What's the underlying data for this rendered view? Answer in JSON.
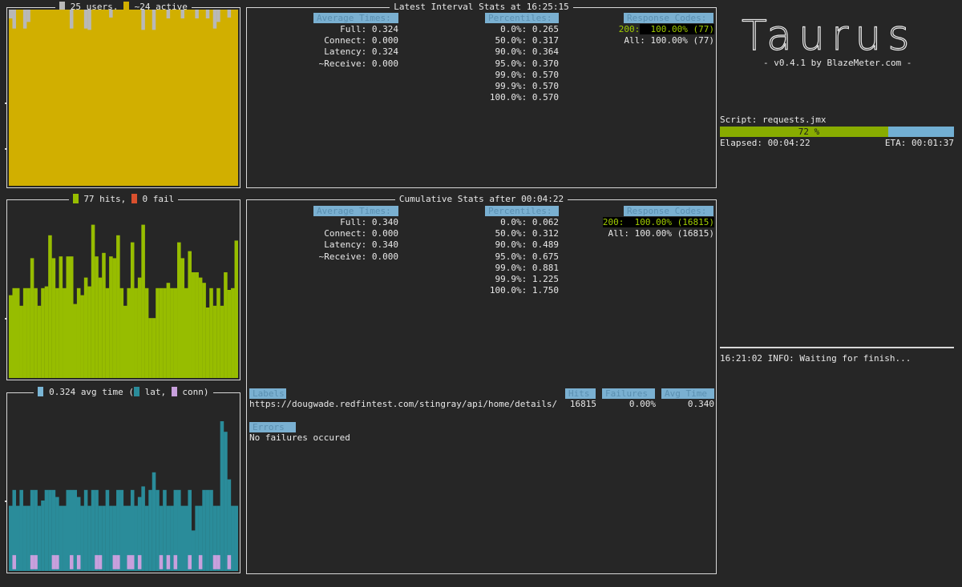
{
  "colors": {
    "users": "#d1af00",
    "users_gray": "#b8b8b8",
    "hits": "#97bd00",
    "fail": "#d9502e",
    "avg": "#7ab6d6",
    "lat": "#2a8c9a",
    "conn": "#c8a0dd",
    "header_bg": "#7ab0d1",
    "progress_fill": "#88ac00",
    "progress_rest": "#72afd3"
  },
  "panels": {
    "users": {
      "users_label": "25 users,",
      "active_label": "~24 active"
    },
    "hits": {
      "hits_label": "77 hits,",
      "fail_label": "0 fail"
    },
    "times": {
      "avg_label": "0.324 avg time (",
      "lat_label": "lat,",
      "conn_label": "conn)"
    }
  },
  "latest": {
    "title": "Latest Interval Stats at 16:25:15",
    "avg_header": "Average Times:",
    "avg_rows": [
      {
        "label": "Full:",
        "value": "0.324"
      },
      {
        "label": "Connect:",
        "value": "0.000"
      },
      {
        "label": "Latency:",
        "value": "0.324"
      },
      {
        "label": "~Receive:",
        "value": "0.000"
      }
    ],
    "pct_header": "Percentiles:",
    "pct_rows": [
      {
        "label": "0.0%:",
        "value": "0.265"
      },
      {
        "label": "50.0%:",
        "value": "0.317"
      },
      {
        "label": "90.0%:",
        "value": "0.364"
      },
      {
        "label": "95.0%:",
        "value": "0.370"
      },
      {
        "label": "99.0%:",
        "value": "0.570"
      },
      {
        "label": "99.9%:",
        "value": "0.570"
      },
      {
        "label": "100.0%:",
        "value": "0.570"
      }
    ],
    "rc_header": "Response Codes:",
    "rc_code": "200:",
    "rc_value": "100.00% (77)",
    "rc_all": "All: 100.00% (77)"
  },
  "cumulative": {
    "title": "Cumulative Stats after 00:04:22",
    "avg_header": "Average Times:",
    "avg_rows": [
      {
        "label": "Full:",
        "value": "0.340"
      },
      {
        "label": "Connect:",
        "value": "0.000"
      },
      {
        "label": "Latency:",
        "value": "0.340"
      },
      {
        "label": "~Receive:",
        "value": "0.000"
      }
    ],
    "pct_header": "Percentiles:",
    "pct_rows": [
      {
        "label": "0.0%:",
        "value": "0.062"
      },
      {
        "label": "50.0%:",
        "value": "0.312"
      },
      {
        "label": "90.0%:",
        "value": "0.489"
      },
      {
        "label": "95.0%:",
        "value": "0.675"
      },
      {
        "label": "99.0%:",
        "value": "0.881"
      },
      {
        "label": "99.9%:",
        "value": "1.225"
      },
      {
        "label": "100.0%:",
        "value": "1.750"
      }
    ],
    "rc_header": "Response Codes:",
    "rc_code": "200:",
    "rc_value": "100.00% (16815)",
    "rc_all": "All: 100.00% (16815)",
    "labels_header": "Labels",
    "hits_header": "Hits",
    "failures_header": "Failures",
    "avgtime_header": "Avg Time",
    "label_row": {
      "url": "https://dougwade.redfintest.com/stingray/api/home/details/",
      "hits": "16815",
      "failures": "0.00%",
      "avg": "0.340"
    },
    "errors_header": "Errors",
    "errors_text": "No failures occured"
  },
  "sidebar": {
    "logo_text": "Taurus",
    "version": "- v0.4.1 by BlazeMeter.com -",
    "script": "Script: requests.jmx",
    "progress_label": "72 %",
    "progress": 0.72,
    "elapsed": "Elapsed: 00:04:22",
    "eta": "ETA: 00:01:37",
    "log": "16:21:02 INFO: Waiting for finish..."
  },
  "charts": {
    "users_gray": [
      0.12,
      0.35,
      0,
      0,
      0.35,
      0.2,
      0,
      0,
      0,
      0,
      0,
      0,
      0,
      0,
      0,
      0,
      0,
      0.35,
      0,
      0,
      0,
      0.35,
      0.38,
      0,
      0,
      0,
      0,
      0,
      0.1,
      0,
      0,
      0,
      0,
      0,
      0,
      0,
      0,
      0.38,
      0,
      0,
      0.38,
      0,
      0,
      0,
      0.12,
      0,
      0,
      0,
      0.12,
      0,
      0,
      0,
      0.12,
      0,
      0,
      0.12,
      0,
      0.35,
      0.2,
      0,
      0,
      0.1,
      0,
      0
    ],
    "hits": [
      0.47,
      0.51,
      0.51,
      0.41,
      0.51,
      0.51,
      0.68,
      0.51,
      0.41,
      0.51,
      0.52,
      0.81,
      0.68,
      0.51,
      0.69,
      0.51,
      0.69,
      0.69,
      0.42,
      0.51,
      0.47,
      0.57,
      0.52,
      0.87,
      0.69,
      0.57,
      0.71,
      0.51,
      0.69,
      0.68,
      0.81,
      0.51,
      0.41,
      0.51,
      0.77,
      0.51,
      0.57,
      0.87,
      0.51,
      0.34,
      0.34,
      0.51,
      0.51,
      0.51,
      0.54,
      0.51,
      0.51,
      0.77,
      0.68,
      0.51,
      0.72,
      0.6,
      0.6,
      0.57,
      0.54,
      0.4,
      0.51,
      0.41,
      0.51,
      0.41,
      0.6,
      0.5,
      0.51,
      0.78
    ],
    "lat": [
      0.37,
      0.46,
      0.37,
      0.46,
      0.37,
      0.37,
      0.46,
      0.46,
      0.37,
      0.4,
      0.46,
      0.46,
      0.46,
      0.42,
      0.37,
      0.37,
      0.46,
      0.46,
      0.46,
      0.42,
      0.37,
      0.46,
      0.37,
      0.46,
      0.46,
      0.37,
      0.37,
      0.46,
      0.37,
      0.37,
      0.46,
      0.46,
      0.37,
      0.37,
      0.46,
      0.37,
      0.42,
      0.48,
      0.37,
      0.46,
      0.56,
      0.46,
      0.37,
      0.46,
      0.37,
      0.37,
      0.46,
      0.46,
      0.37,
      0.37,
      0.46,
      0.23,
      0.37,
      0.37,
      0.46,
      0.46,
      0.46,
      0.37,
      0.37,
      0.85,
      0.79,
      0.52,
      0.37,
      0.37
    ],
    "conn": [
      0,
      0.08,
      0,
      0,
      0,
      0,
      0.08,
      0.08,
      0,
      0,
      0,
      0,
      0.08,
      0.08,
      0,
      0,
      0,
      0.08,
      0,
      0.08,
      0,
      0,
      0,
      0,
      0.08,
      0.08,
      0,
      0,
      0,
      0.08,
      0.08,
      0,
      0,
      0.08,
      0.08,
      0,
      0.08,
      0,
      0,
      0,
      0,
      0,
      0.08,
      0,
      0.08,
      0,
      0.08,
      0,
      0,
      0,
      0.08,
      0,
      0,
      0.08,
      0,
      0,
      0,
      0.08,
      0.08,
      0,
      0,
      0.08,
      0,
      0
    ]
  }
}
